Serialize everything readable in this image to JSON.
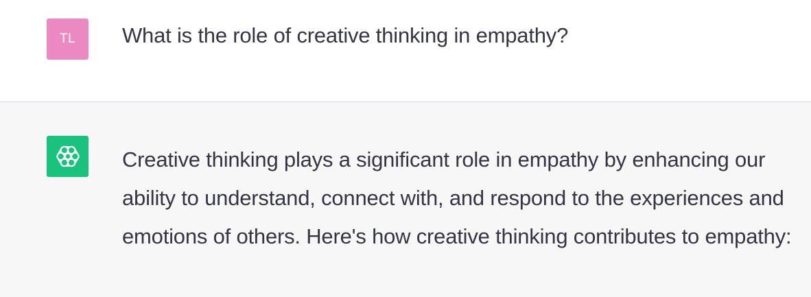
{
  "conversation": {
    "user_turn": {
      "avatar_initials": "TL",
      "avatar_color": "#ec88c2",
      "message": "What is the role of creative thinking in empathy?"
    },
    "assistant_turn": {
      "avatar_icon": "openai-logo-icon",
      "avatar_color": "#19c37d",
      "message": "Creative thinking plays a significant role in empathy by enhancing our ability to understand, connect with, and respond to the experiences and emotions of others. Here's how creative thinking contributes to empathy:"
    }
  },
  "colors": {
    "assistant_background": "#f7f7f8",
    "text": "#343541",
    "divider": "#d9d9e3"
  }
}
